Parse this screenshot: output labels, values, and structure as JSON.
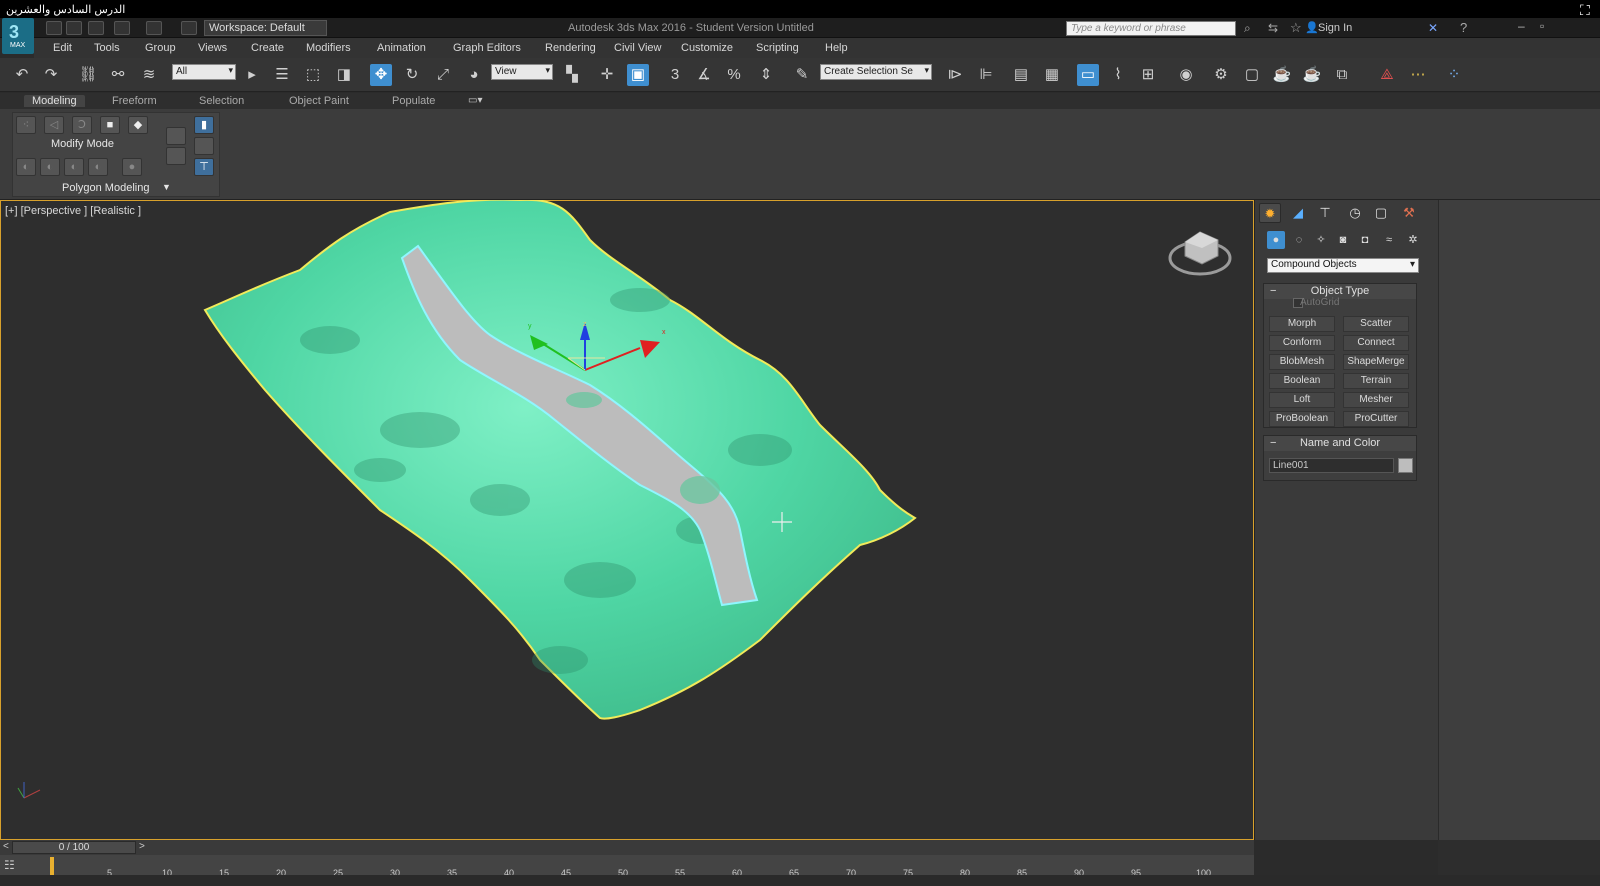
{
  "video_title": "الدرس السادس والعشرين",
  "title_bar": {
    "workspace": "Workspace: Default",
    "app_title": "Autodesk 3ds Max 2016 - Student Version    Untitled",
    "search_placeholder": "Type a keyword or phrase",
    "sign_in": "Sign In",
    "logo_text": "MAX"
  },
  "menu": [
    "Edit",
    "Tools",
    "Group",
    "Views",
    "Create",
    "Modifiers",
    "Animation",
    "Graph Editors",
    "Rendering",
    "Civil View",
    "Customize",
    "Scripting",
    "Help"
  ],
  "toolbar": {
    "filter": "All",
    "ref_coord": "View",
    "selection_set": "Create Selection Se"
  },
  "ribbon": {
    "tabs": [
      "Modeling",
      "Freeform",
      "Selection",
      "Object Paint",
      "Populate"
    ],
    "active_tab": "Modeling",
    "modify_mode": "Modify Mode",
    "polygon_modeling": "Polygon Modeling"
  },
  "viewport": {
    "label": "[+] [Perspective ] [Realistic ]",
    "terrain_color": "#4fd6a4",
    "terrain_outline": "#f1ea5a",
    "road_color": "#bcbcbc",
    "road_outline": "#8ff6ff",
    "axis_labels": {
      "x": "x",
      "y": "y",
      "z": "z"
    }
  },
  "command_panel": {
    "category": "Compound Objects",
    "object_type": {
      "title": "Object Type",
      "autogrid": "AutoGrid",
      "buttons": [
        "Morph",
        "Scatter",
        "Conform",
        "Connect",
        "BlobMesh",
        "ShapeMerge",
        "Boolean",
        "Terrain",
        "Loft",
        "Mesher",
        "ProBoolean",
        "ProCutter"
      ]
    },
    "name_and_color": {
      "title": "Name and Color",
      "name": "Line001",
      "swatch_color": "#bdbdbd"
    }
  },
  "timeline": {
    "slider": "0 / 100",
    "ticks": [
      "5",
      "10",
      "15",
      "20",
      "25",
      "30",
      "35",
      "40",
      "45",
      "50",
      "55",
      "60",
      "65",
      "70",
      "75",
      "80",
      "85",
      "90",
      "95",
      "100"
    ],
    "left_arrow": "<",
    "right_arrow": ">"
  }
}
